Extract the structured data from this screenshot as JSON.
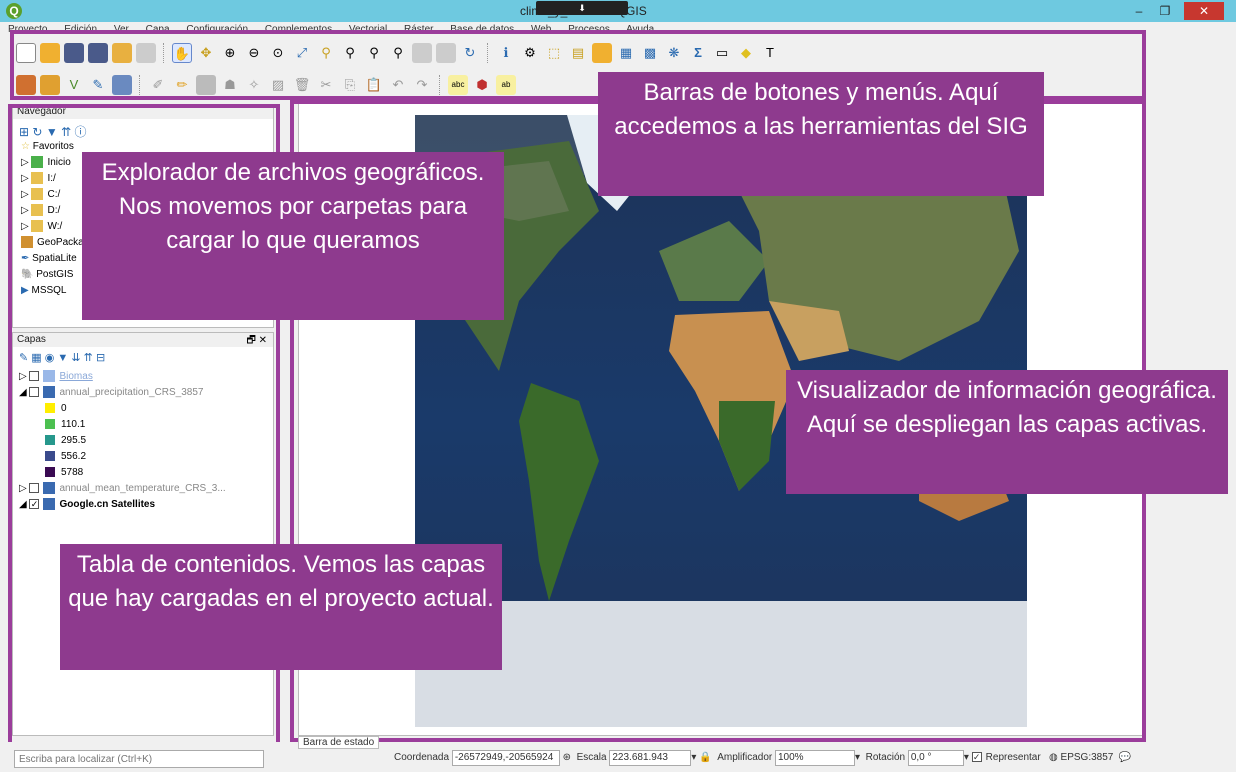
{
  "window": {
    "title": "clima_y_biomas - QGIS",
    "grip_symbol": "⬇"
  },
  "menu": [
    "Proyecto",
    "Edición",
    "Ver",
    "Capa",
    "Configuración",
    "Complementos",
    "Vectorial",
    "Ráster",
    "Base de datos",
    "Web",
    "Procesos",
    "Ayuda"
  ],
  "navigator": {
    "title": "Navegador",
    "items": [
      "Favoritos",
      "Inicio",
      "I:/",
      "C:/",
      "D:/",
      "W:/",
      "GeoPackage",
      "SpatiaLite",
      "PostGIS",
      "MSSQL"
    ]
  },
  "layers": {
    "title": "Capas",
    "biomas": "Biomas",
    "precip": "annual_precipitation_CRS_3857",
    "legend": [
      {
        "label": "0",
        "color": "#ffee00"
      },
      {
        "label": "110.1",
        "color": "#4cc050"
      },
      {
        "label": "295.5",
        "color": "#26988c"
      },
      {
        "label": "556.2",
        "color": "#3a4a8c"
      },
      {
        "label": "5788",
        "color": "#3a0a52"
      }
    ],
    "temp": "annual_mean_temperature_CRS_3...",
    "google": "Google.cn Satellites"
  },
  "callouts": {
    "toolbars": "Barras de botones y menús. Aquí accedemos a las herramientas del SIG",
    "navigator": "Explorador de archivos geográficos. Nos movemos por carpetas para cargar lo que queramos",
    "map": "Visualizador de información geográfica. Aquí se despliegan las capas activas.",
    "toc": "Tabla de contenidos. Vemos las capas que hay cargadas en el proyecto actual."
  },
  "statusbar": {
    "tab": "Barra de estado",
    "search_placeholder": "Escriba para localizar (Ctrl+K)",
    "coord_label": "Coordenada",
    "coord_value": "-26572949,-20565924",
    "scale_label": "Escala",
    "scale_value": "223.681.943",
    "magnifier_label": "Amplificador",
    "magnifier_value": "100%",
    "rotation_label": "Rotación",
    "rotation_value": "0,0 °",
    "render_label": "Representar",
    "crs": "EPSG:3857"
  },
  "colors": {
    "accent": "#8e3a8e",
    "titlebar": "#6ec9e0"
  }
}
